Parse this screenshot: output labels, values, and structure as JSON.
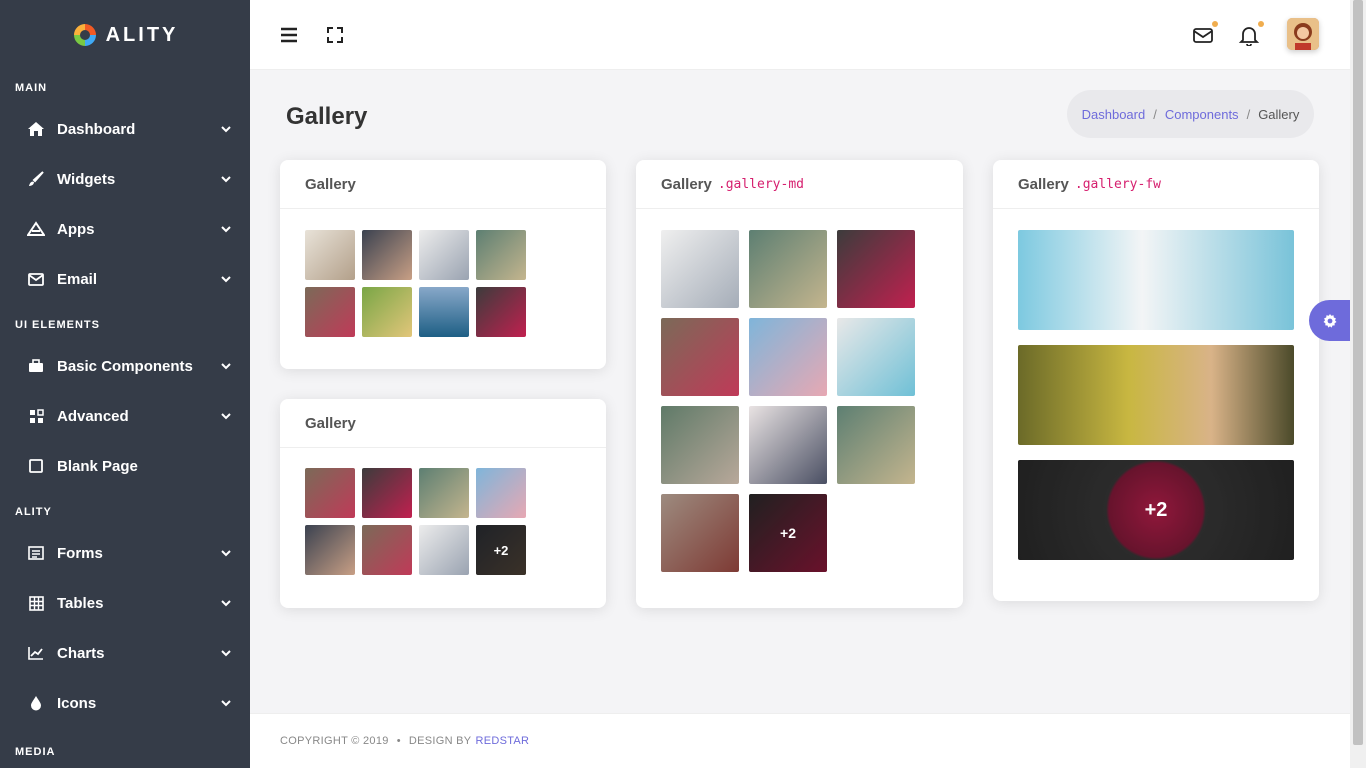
{
  "brand": {
    "name": "ALITY"
  },
  "sidebar": {
    "sections": [
      {
        "header": "MAIN",
        "items": [
          {
            "label": "Dashboard",
            "icon": "home-icon",
            "chevron": true
          },
          {
            "label": "Widgets",
            "icon": "brush-icon",
            "chevron": true
          },
          {
            "label": "Apps",
            "icon": "apps-icon",
            "chevron": true
          },
          {
            "label": "Email",
            "icon": "envelope-icon",
            "chevron": true
          }
        ]
      },
      {
        "header": "UI ELEMENTS",
        "items": [
          {
            "label": "Basic Components",
            "icon": "briefcase-icon",
            "chevron": true
          },
          {
            "label": "Advanced",
            "icon": "grid-icon",
            "chevron": true
          },
          {
            "label": "Blank Page",
            "icon": "square-icon",
            "chevron": false
          }
        ]
      },
      {
        "header": "ALITY",
        "items": [
          {
            "label": "Forms",
            "icon": "form-icon",
            "chevron": true
          },
          {
            "label": "Tables",
            "icon": "table-icon",
            "chevron": true
          },
          {
            "label": "Charts",
            "icon": "chart-icon",
            "chevron": true
          },
          {
            "label": "Icons",
            "icon": "drop-icon",
            "chevron": true
          }
        ]
      },
      {
        "header": "MEDIA",
        "items": []
      }
    ]
  },
  "page": {
    "title": "Gallery"
  },
  "breadcrumb": {
    "items": [
      "Dashboard",
      "Components"
    ],
    "current": "Gallery"
  },
  "cards": {
    "gallery_sm_1": {
      "title": "Gallery",
      "code": ""
    },
    "gallery_sm_2": {
      "title": "Gallery",
      "code": "",
      "more": "+2"
    },
    "gallery_md": {
      "title": "Gallery",
      "code": ".gallery-md",
      "more": "+2"
    },
    "gallery_fw": {
      "title": "Gallery",
      "code": ".gallery-fw",
      "more": "+2"
    }
  },
  "footer": {
    "copyright": "COPYRIGHT © 2019",
    "design_by": "DESIGN BY",
    "designer": "REDSTAR"
  },
  "colors": {
    "sidebar": "#353c48",
    "accent": "#6e6bdb",
    "code": "#d6206f",
    "notif": "#f0ad4e"
  }
}
